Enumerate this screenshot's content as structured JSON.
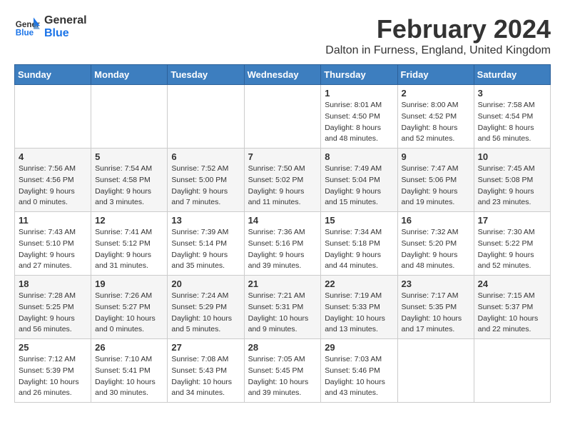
{
  "header": {
    "logo_line1": "General",
    "logo_line2": "Blue",
    "month_title": "February 2024",
    "subtitle": "Dalton in Furness, England, United Kingdom"
  },
  "days_of_week": [
    "Sunday",
    "Monday",
    "Tuesday",
    "Wednesday",
    "Thursday",
    "Friday",
    "Saturday"
  ],
  "weeks": [
    [
      {
        "day": "",
        "info": ""
      },
      {
        "day": "",
        "info": ""
      },
      {
        "day": "",
        "info": ""
      },
      {
        "day": "",
        "info": ""
      },
      {
        "day": "1",
        "info": "Sunrise: 8:01 AM\nSunset: 4:50 PM\nDaylight: 8 hours\nand 48 minutes."
      },
      {
        "day": "2",
        "info": "Sunrise: 8:00 AM\nSunset: 4:52 PM\nDaylight: 8 hours\nand 52 minutes."
      },
      {
        "day": "3",
        "info": "Sunrise: 7:58 AM\nSunset: 4:54 PM\nDaylight: 8 hours\nand 56 minutes."
      }
    ],
    [
      {
        "day": "4",
        "info": "Sunrise: 7:56 AM\nSunset: 4:56 PM\nDaylight: 9 hours\nand 0 minutes."
      },
      {
        "day": "5",
        "info": "Sunrise: 7:54 AM\nSunset: 4:58 PM\nDaylight: 9 hours\nand 3 minutes."
      },
      {
        "day": "6",
        "info": "Sunrise: 7:52 AM\nSunset: 5:00 PM\nDaylight: 9 hours\nand 7 minutes."
      },
      {
        "day": "7",
        "info": "Sunrise: 7:50 AM\nSunset: 5:02 PM\nDaylight: 9 hours\nand 11 minutes."
      },
      {
        "day": "8",
        "info": "Sunrise: 7:49 AM\nSunset: 5:04 PM\nDaylight: 9 hours\nand 15 minutes."
      },
      {
        "day": "9",
        "info": "Sunrise: 7:47 AM\nSunset: 5:06 PM\nDaylight: 9 hours\nand 19 minutes."
      },
      {
        "day": "10",
        "info": "Sunrise: 7:45 AM\nSunset: 5:08 PM\nDaylight: 9 hours\nand 23 minutes."
      }
    ],
    [
      {
        "day": "11",
        "info": "Sunrise: 7:43 AM\nSunset: 5:10 PM\nDaylight: 9 hours\nand 27 minutes."
      },
      {
        "day": "12",
        "info": "Sunrise: 7:41 AM\nSunset: 5:12 PM\nDaylight: 9 hours\nand 31 minutes."
      },
      {
        "day": "13",
        "info": "Sunrise: 7:39 AM\nSunset: 5:14 PM\nDaylight: 9 hours\nand 35 minutes."
      },
      {
        "day": "14",
        "info": "Sunrise: 7:36 AM\nSunset: 5:16 PM\nDaylight: 9 hours\nand 39 minutes."
      },
      {
        "day": "15",
        "info": "Sunrise: 7:34 AM\nSunset: 5:18 PM\nDaylight: 9 hours\nand 44 minutes."
      },
      {
        "day": "16",
        "info": "Sunrise: 7:32 AM\nSunset: 5:20 PM\nDaylight: 9 hours\nand 48 minutes."
      },
      {
        "day": "17",
        "info": "Sunrise: 7:30 AM\nSunset: 5:22 PM\nDaylight: 9 hours\nand 52 minutes."
      }
    ],
    [
      {
        "day": "18",
        "info": "Sunrise: 7:28 AM\nSunset: 5:25 PM\nDaylight: 9 hours\nand 56 minutes."
      },
      {
        "day": "19",
        "info": "Sunrise: 7:26 AM\nSunset: 5:27 PM\nDaylight: 10 hours\nand 0 minutes."
      },
      {
        "day": "20",
        "info": "Sunrise: 7:24 AM\nSunset: 5:29 PM\nDaylight: 10 hours\nand 5 minutes."
      },
      {
        "day": "21",
        "info": "Sunrise: 7:21 AM\nSunset: 5:31 PM\nDaylight: 10 hours\nand 9 minutes."
      },
      {
        "day": "22",
        "info": "Sunrise: 7:19 AM\nSunset: 5:33 PM\nDaylight: 10 hours\nand 13 minutes."
      },
      {
        "day": "23",
        "info": "Sunrise: 7:17 AM\nSunset: 5:35 PM\nDaylight: 10 hours\nand 17 minutes."
      },
      {
        "day": "24",
        "info": "Sunrise: 7:15 AM\nSunset: 5:37 PM\nDaylight: 10 hours\nand 22 minutes."
      }
    ],
    [
      {
        "day": "25",
        "info": "Sunrise: 7:12 AM\nSunset: 5:39 PM\nDaylight: 10 hours\nand 26 minutes."
      },
      {
        "day": "26",
        "info": "Sunrise: 7:10 AM\nSunset: 5:41 PM\nDaylight: 10 hours\nand 30 minutes."
      },
      {
        "day": "27",
        "info": "Sunrise: 7:08 AM\nSunset: 5:43 PM\nDaylight: 10 hours\nand 34 minutes."
      },
      {
        "day": "28",
        "info": "Sunrise: 7:05 AM\nSunset: 5:45 PM\nDaylight: 10 hours\nand 39 minutes."
      },
      {
        "day": "29",
        "info": "Sunrise: 7:03 AM\nSunset: 5:46 PM\nDaylight: 10 hours\nand 43 minutes."
      },
      {
        "day": "",
        "info": ""
      },
      {
        "day": "",
        "info": ""
      }
    ]
  ]
}
